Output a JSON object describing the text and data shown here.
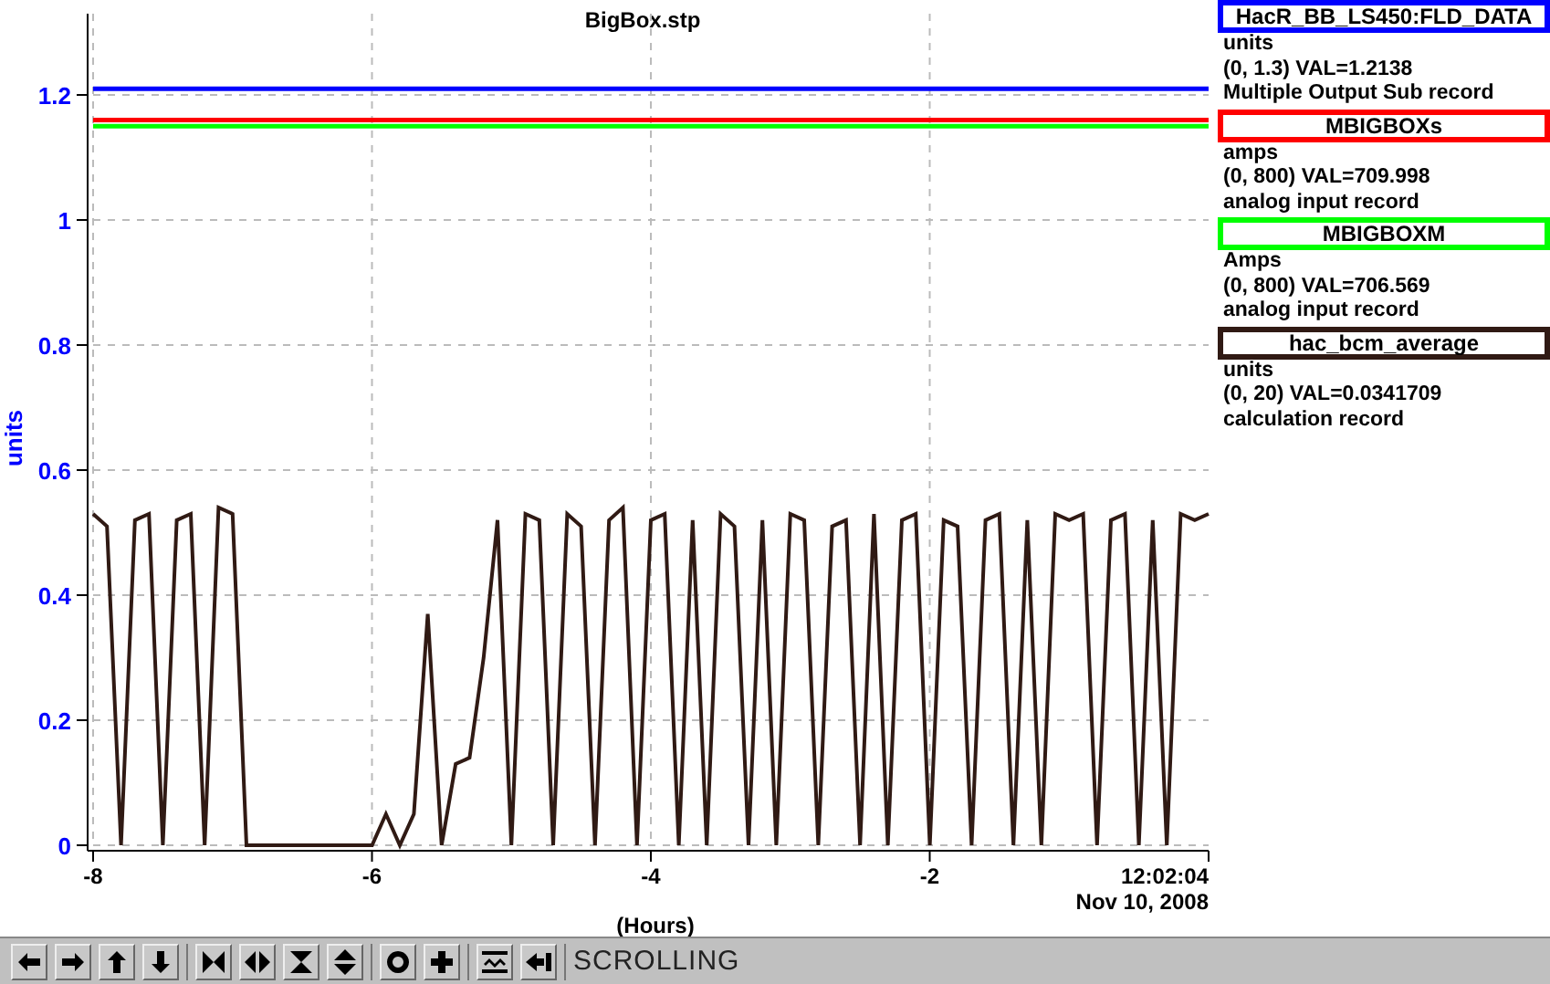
{
  "chart": {
    "chart_data": {
      "type": "line",
      "title": "BigBox.stp",
      "xlabel": "(Hours)",
      "ylabel": "units",
      "xlim": [
        -8,
        0
      ],
      "ylim": [
        0,
        1.33
      ],
      "grid": true,
      "xticks": [
        -8,
        -6,
        -4,
        -2
      ],
      "yticks": [
        0,
        0.2,
        0.4,
        0.6,
        0.8,
        1,
        1.2
      ],
      "x": [
        -8,
        -7.9,
        -7.8,
        -7.7,
        -7.6,
        -7.5,
        -7.4,
        -7.3,
        -7.2,
        -7.1,
        -7,
        -6.9,
        -6.8,
        -6.7,
        -6.6,
        -6.5,
        -6.4,
        -6.3,
        -6.2,
        -6.1,
        -6,
        -5.9,
        -5.8,
        -5.7,
        -5.6,
        -5.5,
        -5.4,
        -5.3,
        -5.2,
        -5.1,
        -5,
        -4.9,
        -4.8,
        -4.7,
        -4.6,
        -4.5,
        -4.4,
        -4.3,
        -4.2,
        -4.1,
        -4,
        -3.9,
        -3.8,
        -3.7,
        -3.6,
        -3.5,
        -3.4,
        -3.3,
        -3.2,
        -3.1,
        -3,
        -2.9,
        -2.8,
        -2.7,
        -2.6,
        -2.5,
        -2.4,
        -2.3,
        -2.2,
        -2.1,
        -2,
        -1.9,
        -1.8,
        -1.7,
        -1.6,
        -1.5,
        -1.4,
        -1.3,
        -1.2,
        -1.1,
        -1,
        -0.9,
        -0.8,
        -0.7,
        -0.6,
        -0.5,
        -0.4,
        -0.3,
        -0.2,
        -0.1,
        0
      ],
      "series": [
        {
          "name": "HacR_BB_LS450:FLD_DATA",
          "color": "#0000ff",
          "values": [
            1.21,
            1.21,
            1.21,
            1.21,
            1.21,
            1.21,
            1.21,
            1.21,
            1.21,
            1.21,
            1.21,
            1.21,
            1.21,
            1.21,
            1.21,
            1.21,
            1.21,
            1.21,
            1.21,
            1.21,
            1.21,
            1.21,
            1.21,
            1.21,
            1.21,
            1.21,
            1.21,
            1.21,
            1.21,
            1.21,
            1.21,
            1.21,
            1.21,
            1.21,
            1.21,
            1.21,
            1.21,
            1.21,
            1.21,
            1.21,
            1.21,
            1.21,
            1.21,
            1.21,
            1.21,
            1.21,
            1.21,
            1.21,
            1.21,
            1.21,
            1.21,
            1.21,
            1.21,
            1.21,
            1.21,
            1.21,
            1.21,
            1.21,
            1.21,
            1.21,
            1.21,
            1.21,
            1.21,
            1.21,
            1.21,
            1.21,
            1.21,
            1.21,
            1.21,
            1.21,
            1.21,
            1.21,
            1.21,
            1.21,
            1.21,
            1.21,
            1.21,
            1.21,
            1.21,
            1.21,
            1.21
          ]
        },
        {
          "name": "MBIGBOXs",
          "color": "#ff0000",
          "values": [
            1.16,
            1.16,
            1.16,
            1.16,
            1.16,
            1.16,
            1.16,
            1.16,
            1.16,
            1.16,
            1.16,
            1.16,
            1.16,
            1.16,
            1.16,
            1.16,
            1.16,
            1.16,
            1.16,
            1.16,
            1.16,
            1.16,
            1.16,
            1.16,
            1.16,
            1.16,
            1.16,
            1.16,
            1.16,
            1.16,
            1.16,
            1.16,
            1.16,
            1.16,
            1.16,
            1.16,
            1.16,
            1.16,
            1.16,
            1.16,
            1.16,
            1.16,
            1.16,
            1.16,
            1.16,
            1.16,
            1.16,
            1.16,
            1.16,
            1.16,
            1.16,
            1.16,
            1.16,
            1.16,
            1.16,
            1.16,
            1.16,
            1.16,
            1.16,
            1.16,
            1.16,
            1.16,
            1.16,
            1.16,
            1.16,
            1.16,
            1.16,
            1.16,
            1.16,
            1.16,
            1.16,
            1.16,
            1.16,
            1.16,
            1.16,
            1.16,
            1.16,
            1.16,
            1.16,
            1.16,
            1.16
          ]
        },
        {
          "name": "MBIGBOXM",
          "color": "#00ff00",
          "values": [
            1.15,
            1.15,
            1.15,
            1.15,
            1.15,
            1.15,
            1.15,
            1.15,
            1.15,
            1.15,
            1.15,
            1.15,
            1.15,
            1.15,
            1.15,
            1.15,
            1.15,
            1.15,
            1.15,
            1.15,
            1.15,
            1.15,
            1.15,
            1.15,
            1.15,
            1.15,
            1.15,
            1.15,
            1.15,
            1.15,
            1.15,
            1.15,
            1.15,
            1.15,
            1.15,
            1.15,
            1.15,
            1.15,
            1.15,
            1.15,
            1.15,
            1.15,
            1.15,
            1.15,
            1.15,
            1.15,
            1.15,
            1.15,
            1.15,
            1.15,
            1.15,
            1.15,
            1.15,
            1.15,
            1.15,
            1.15,
            1.15,
            1.15,
            1.15,
            1.15,
            1.15,
            1.15,
            1.15,
            1.15,
            1.15,
            1.15,
            1.15,
            1.15,
            1.15,
            1.15,
            1.15,
            1.15,
            1.15,
            1.15,
            1.15,
            1.15,
            1.15,
            1.15,
            1.15,
            1.15,
            1.15
          ]
        },
        {
          "name": "hac_bcm_average",
          "color": "#301a14",
          "values": [
            0.53,
            0.51,
            0,
            0.52,
            0.53,
            0,
            0.52,
            0.53,
            0,
            0.54,
            0.53,
            0,
            0,
            0,
            0,
            0,
            0,
            0,
            0,
            0,
            0,
            0.05,
            0,
            0.05,
            0.37,
            0,
            0.13,
            0.14,
            0.3,
            0.52,
            0,
            0.53,
            0.52,
            0,
            0.53,
            0.51,
            0,
            0.52,
            0.54,
            0,
            0.52,
            0.53,
            0,
            0.52,
            0,
            0.53,
            0.51,
            0,
            0.52,
            0,
            0.53,
            0.52,
            0,
            0.51,
            0.52,
            0,
            0.53,
            0,
            0.52,
            0.53,
            0,
            0.52,
            0.51,
            0,
            0.52,
            0.53,
            0,
            0.52,
            0,
            0.53,
            0.52,
            0.53,
            0,
            0.52,
            0.53,
            0,
            0.52,
            0,
            0.53,
            0.52,
            0.53
          ]
        }
      ]
    },
    "time": "12:02:04",
    "date": "Nov 10, 2008"
  },
  "legend": [
    {
      "units": "units",
      "range_value": "(0, 1.3) VAL=1.2138",
      "record_type": "Multiple Output Sub record"
    },
    {
      "units": "amps",
      "range_value": "(0, 800) VAL=709.998",
      "record_type": "analog input record"
    },
    {
      "units": "Amps",
      "range_value": "(0, 800) VAL=706.569",
      "record_type": "analog input record"
    },
    {
      "units": "units",
      "range_value": "(0, 20) VAL=0.0341709",
      "record_type": "calculation record"
    }
  ],
  "toolbar": {
    "mode": "SCROLLING"
  }
}
